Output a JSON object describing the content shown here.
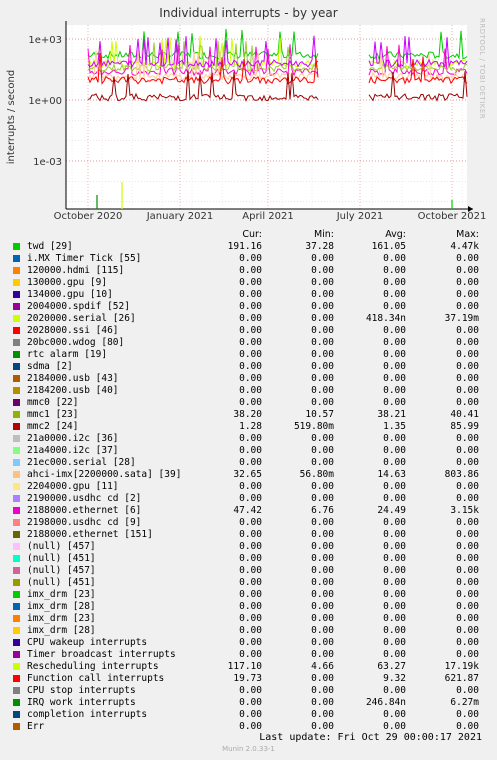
{
  "chart_data": {
    "type": "line",
    "title": "Individual interrupts - by year",
    "ylabel": "interrupts / second",
    "y_scale": "log",
    "y_ticks": [
      "1e+03",
      "1e+00",
      "1e-03"
    ],
    "x_ticks": [
      "October 2020",
      "January 2021",
      "April 2021",
      "July 2021",
      "October 2021"
    ],
    "grid": true,
    "watermark": "RRDTOOL / TOBI OETIKER",
    "series": [
      {
        "name": "twd [29]",
        "color": "#00cc00",
        "level": 161.05
      },
      {
        "name": "2020000.serial [26]",
        "color": "#ccff00",
        "level": 60
      },
      {
        "name": "2188000.ethernet [6]",
        "color": "#ff00cc",
        "level": 24.49
      },
      {
        "name": "mmc1 [23]",
        "color": "#99cc33",
        "level": 38.21
      },
      {
        "name": "ahci-imx[2200000.sata] [39]",
        "color": "#ffcc99",
        "level": 14.63
      },
      {
        "name": "Rescheduling interrupts",
        "color": "#cc00ff",
        "level": 63.27
      },
      {
        "name": "Function call interrupts",
        "color": "#ff0000",
        "level": 9.32
      },
      {
        "name": "mmc2 [24]",
        "color": "#990000",
        "level": 1.35
      }
    ]
  },
  "legend": {
    "headers": [
      "Cur:",
      "Min:",
      "Avg:",
      "Max:"
    ],
    "rows": [
      {
        "name": "twd [29]",
        "color": "#00cc00",
        "cur": "191.16",
        "min": "37.28",
        "avg": "161.05",
        "max": "4.47k"
      },
      {
        "name": "i.MX Timer Tick [55]",
        "color": "#0066b3",
        "cur": "0.00",
        "min": "0.00",
        "avg": "0.00",
        "max": "0.00"
      },
      {
        "name": "120000.hdmi [115]",
        "color": "#ff8000",
        "cur": "0.00",
        "min": "0.00",
        "avg": "0.00",
        "max": "0.00"
      },
      {
        "name": "130000.gpu [9]",
        "color": "#ffcc00",
        "cur": "0.00",
        "min": "0.00",
        "avg": "0.00",
        "max": "0.00"
      },
      {
        "name": "134000.gpu [10]",
        "color": "#330099",
        "cur": "0.00",
        "min": "0.00",
        "avg": "0.00",
        "max": "0.00"
      },
      {
        "name": "2004000.spdif [52]",
        "color": "#990099",
        "cur": "0.00",
        "min": "0.00",
        "avg": "0.00",
        "max": "0.00"
      },
      {
        "name": "2020000.serial [26]",
        "color": "#ccff00",
        "cur": "0.00",
        "min": "0.00",
        "avg": "418.34n",
        "max": "37.19m"
      },
      {
        "name": "2028000.ssi [46]",
        "color": "#ff0000",
        "cur": "0.00",
        "min": "0.00",
        "avg": "0.00",
        "max": "0.00"
      },
      {
        "name": "20bc000.wdog [80]",
        "color": "#808080",
        "cur": "0.00",
        "min": "0.00",
        "avg": "0.00",
        "max": "0.00"
      },
      {
        "name": "rtc alarm [19]",
        "color": "#008f00",
        "cur": "0.00",
        "min": "0.00",
        "avg": "0.00",
        "max": "0.00"
      },
      {
        "name": "sdma [2]",
        "color": "#00487d",
        "cur": "0.00",
        "min": "0.00",
        "avg": "0.00",
        "max": "0.00"
      },
      {
        "name": "2184000.usb [43]",
        "color": "#b35a00",
        "cur": "0.00",
        "min": "0.00",
        "avg": "0.00",
        "max": "0.00"
      },
      {
        "name": "2184200.usb [40]",
        "color": "#b38f00",
        "cur": "0.00",
        "min": "0.00",
        "avg": "0.00",
        "max": "0.00"
      },
      {
        "name": "mmc0 [22]",
        "color": "#6b006b",
        "cur": "0.00",
        "min": "0.00",
        "avg": "0.00",
        "max": "0.00"
      },
      {
        "name": "mmc1 [23]",
        "color": "#8fb300",
        "cur": "38.20",
        "min": "10.57",
        "avg": "38.21",
        "max": "40.41"
      },
      {
        "name": "mmc2 [24]",
        "color": "#b30000",
        "cur": "1.28",
        "min": "519.80m",
        "avg": "1.35",
        "max": "85.99"
      },
      {
        "name": "21a0000.i2c [36]",
        "color": "#bebebe",
        "cur": "0.00",
        "min": "0.00",
        "avg": "0.00",
        "max": "0.00"
      },
      {
        "name": "21a4000.i2c [37]",
        "color": "#80ff80",
        "cur": "0.00",
        "min": "0.00",
        "avg": "0.00",
        "max": "0.00"
      },
      {
        "name": "21ec000.serial [28]",
        "color": "#80c9ff",
        "cur": "0.00",
        "min": "0.00",
        "avg": "0.00",
        "max": "0.00"
      },
      {
        "name": "ahci-imx[2200000.sata] [39]",
        "color": "#ffc080",
        "cur": "32.65",
        "min": "56.80m",
        "avg": "14.63",
        "max": "803.86"
      },
      {
        "name": "2204000.gpu [11]",
        "color": "#ffe680",
        "cur": "0.00",
        "min": "0.00",
        "avg": "0.00",
        "max": "0.00"
      },
      {
        "name": "2190000.usdhc cd [2]",
        "color": "#aa80ff",
        "cur": "0.00",
        "min": "0.00",
        "avg": "0.00",
        "max": "0.00"
      },
      {
        "name": "2188000.ethernet [6]",
        "color": "#ee00cc",
        "cur": "47.42",
        "min": "6.76",
        "avg": "24.49",
        "max": "3.15k"
      },
      {
        "name": "2198000.usdhc cd [9]",
        "color": "#ff8080",
        "cur": "0.00",
        "min": "0.00",
        "avg": "0.00",
        "max": "0.00"
      },
      {
        "name": "2188000.ethernet [151]",
        "color": "#666600",
        "cur": "0.00",
        "min": "0.00",
        "avg": "0.00",
        "max": "0.00"
      },
      {
        "name": "(null) [457]",
        "color": "#ffbfff",
        "cur": "0.00",
        "min": "0.00",
        "avg": "0.00",
        "max": "0.00"
      },
      {
        "name": "(null) [451]",
        "color": "#00ffcc",
        "cur": "0.00",
        "min": "0.00",
        "avg": "0.00",
        "max": "0.00"
      },
      {
        "name": "(null) [457]",
        "color": "#cc6699",
        "cur": "0.00",
        "min": "0.00",
        "avg": "0.00",
        "max": "0.00"
      },
      {
        "name": "(null) [451]",
        "color": "#999900",
        "cur": "0.00",
        "min": "0.00",
        "avg": "0.00",
        "max": "0.00"
      },
      {
        "name": "imx_drm [23]",
        "color": "#00cc00",
        "cur": "0.00",
        "min": "0.00",
        "avg": "0.00",
        "max": "0.00"
      },
      {
        "name": "imx_drm [28]",
        "color": "#0066b3",
        "cur": "0.00",
        "min": "0.00",
        "avg": "0.00",
        "max": "0.00"
      },
      {
        "name": "imx_drm [23]",
        "color": "#ff8000",
        "cur": "0.00",
        "min": "0.00",
        "avg": "0.00",
        "max": "0.00"
      },
      {
        "name": "imx_drm [28]",
        "color": "#ffcc00",
        "cur": "0.00",
        "min": "0.00",
        "avg": "0.00",
        "max": "0.00"
      },
      {
        "name": "CPU wakeup interrupts",
        "color": "#330099",
        "cur": "0.00",
        "min": "0.00",
        "avg": "0.00",
        "max": "0.00"
      },
      {
        "name": "Timer broadcast interrupts",
        "color": "#990099",
        "cur": "0.00",
        "min": "0.00",
        "avg": "0.00",
        "max": "0.00"
      },
      {
        "name": "Rescheduling interrupts",
        "color": "#ccff00",
        "cur": "117.10",
        "min": "4.66",
        "avg": "63.27",
        "max": "17.19k"
      },
      {
        "name": "Function call interrupts",
        "color": "#ff0000",
        "cur": "19.73",
        "min": "0.00",
        "avg": "9.32",
        "max": "621.87"
      },
      {
        "name": "CPU stop interrupts",
        "color": "#808080",
        "cur": "0.00",
        "min": "0.00",
        "avg": "0.00",
        "max": "0.00"
      },
      {
        "name": "IRQ work interrupts",
        "color": "#008f00",
        "cur": "0.00",
        "min": "0.00",
        "avg": "246.84n",
        "max": "6.27m"
      },
      {
        "name": "completion interrupts",
        "color": "#00487d",
        "cur": "0.00",
        "min": "0.00",
        "avg": "0.00",
        "max": "0.00"
      },
      {
        "name": "Err",
        "color": "#b35a00",
        "cur": "0.00",
        "min": "0.00",
        "avg": "0.00",
        "max": "0.00"
      }
    ]
  },
  "last_update": "Last update:  Fri Oct 29 00:00:17 2021",
  "footer": "Munin 2.0.33-1"
}
